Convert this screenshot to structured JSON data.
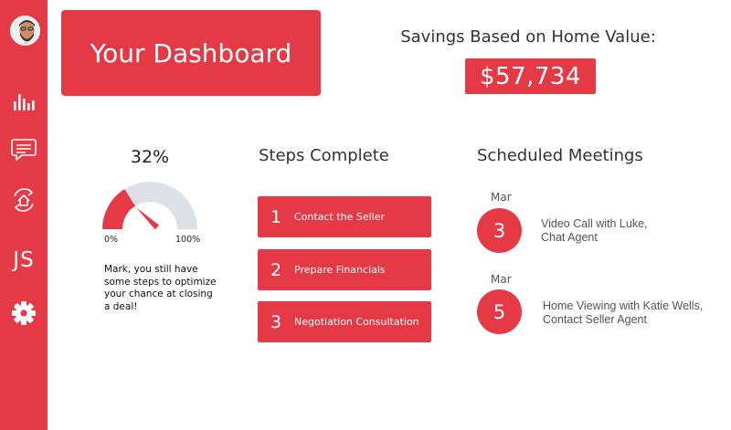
{
  "sidebar": {
    "accent": "#e63946",
    "icons": [
      "bar-chart-icon",
      "chat-bubble-icon",
      "home-refresh-icon",
      "initials-badge",
      "gear-icon"
    ],
    "initials": "JS"
  },
  "header": {
    "title": "Your Dashboard",
    "savings_label": "Savings Based on Home Value:",
    "savings_value": "$57,734"
  },
  "progress": {
    "percent_label": "32%",
    "value": 0.32,
    "min_label": "0%",
    "max_label": "100%",
    "message": "Mark, you still have some steps to optimize your chance at closing a deal!",
    "fill_color": "#e63946",
    "track_color": "#dde1e6"
  },
  "steps": {
    "title": "Steps Complete",
    "items": [
      {
        "number": "1",
        "label": "Contact the Seller"
      },
      {
        "number": "2",
        "label": "Prepare Financials"
      },
      {
        "number": "3",
        "label": "Negotiation Consultation"
      }
    ]
  },
  "meetings": {
    "title": "Scheduled Meetings",
    "items": [
      {
        "month": "Mar",
        "day": "3",
        "line1": "Video Call with Luke,",
        "line2": "Chat Agent"
      },
      {
        "month": "Mar",
        "day": "5",
        "line1": "Home Viewing with Katie Wells,",
        "line2": "Contact Seller Agent"
      }
    ]
  }
}
